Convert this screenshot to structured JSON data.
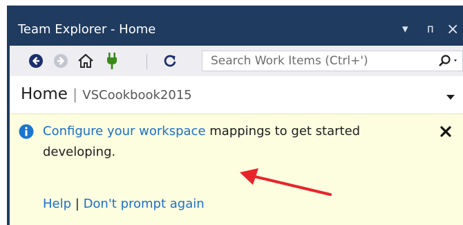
{
  "window": {
    "title": "Team Explorer - Home",
    "controls": {
      "dropdown": "▾",
      "pin": "ᴨ",
      "close": "×"
    }
  },
  "toolbar": {
    "buttons": [
      "back-icon",
      "forward-icon",
      "home-icon",
      "connect-plug-icon",
      "refresh-icon"
    ],
    "search_placeholder": "Search Work Items (Ctrl+')"
  },
  "home": {
    "title": "Home",
    "separator": "|",
    "project": "VSCookbook2015"
  },
  "banner": {
    "link_text": "Configure your workspace",
    "message_rest": " mappings to get started developing.",
    "help_link": "Help",
    "links_separator": " | ",
    "dont_prompt_link": "Don't prompt again"
  },
  "colors": {
    "title_bar": "#1f3b5f",
    "toolbar": "#eeeef2",
    "banner": "#fdfde0",
    "link": "#1a6fc9",
    "info_icon": "#1b75cf",
    "annotation_arrow": "#e8242a",
    "plug_icon": "#3a8a1a"
  }
}
